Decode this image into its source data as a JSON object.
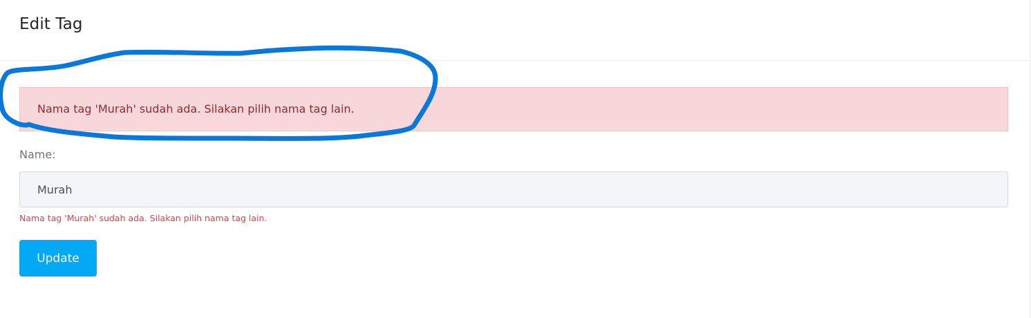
{
  "header": {
    "title": "Edit Tag"
  },
  "alert": {
    "message": "Nama tag 'Murah' sudah ada. Silakan pilih nama tag lain."
  },
  "form": {
    "name_label": "Name:",
    "name_value": "Murah",
    "name_error": "Nama tag 'Murah' sudah ada. Silakan pilih nama tag lain.",
    "submit_label": "Update"
  },
  "colors": {
    "alert_bg": "#f8d7da",
    "alert_text": "#8a2c34",
    "error_text": "#d9434c",
    "button_bg": "#03a9f4",
    "annotation_stroke": "#0a78d8"
  }
}
